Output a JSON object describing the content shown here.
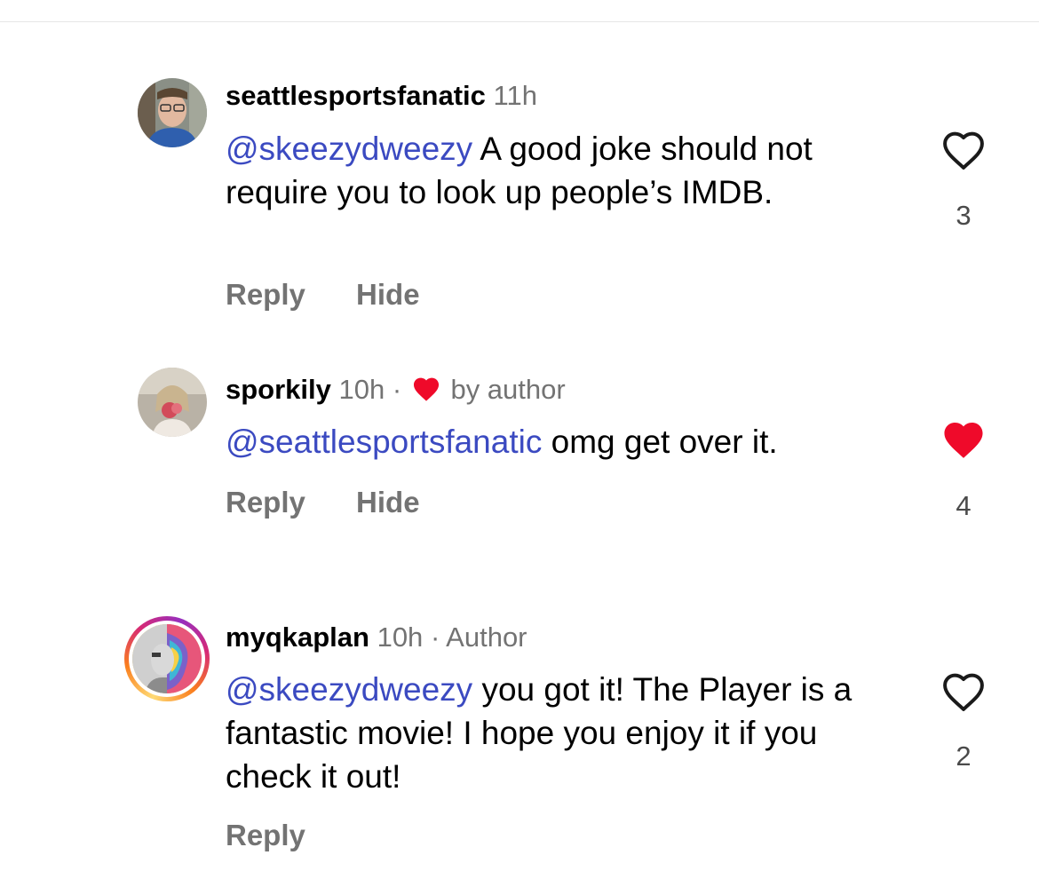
{
  "comments": [
    {
      "username": "seattlesportsfanatic",
      "time": "11h",
      "mention": "@skeezydweezy",
      "text": " A good joke should not require you to look up people’s IMDB.",
      "actions": {
        "reply": "Reply",
        "hide": "Hide"
      },
      "likes": "3",
      "liked": false
    },
    {
      "username": "sporkily",
      "time": "10h",
      "separator": "·",
      "badge": "by author",
      "mention": "@seattlesportsfanatic",
      "text": " omg get over it.",
      "actions": {
        "reply": "Reply",
        "hide": "Hide"
      },
      "likes": "4",
      "liked": true
    },
    {
      "username": "myqkaplan",
      "time": "10h",
      "separator": "·",
      "badge": "Author",
      "mention": "@skeezydweezy",
      "text": " you got it! The Player is a fantastic movie! I hope you enjoy it if you check it out!",
      "actions": {
        "reply": "Reply"
      },
      "likes": "2",
      "liked": false
    }
  ],
  "colors": {
    "mention": "#3b4ac1",
    "secondary_text": "#737373",
    "liked_heart": "#ef0a2a"
  }
}
